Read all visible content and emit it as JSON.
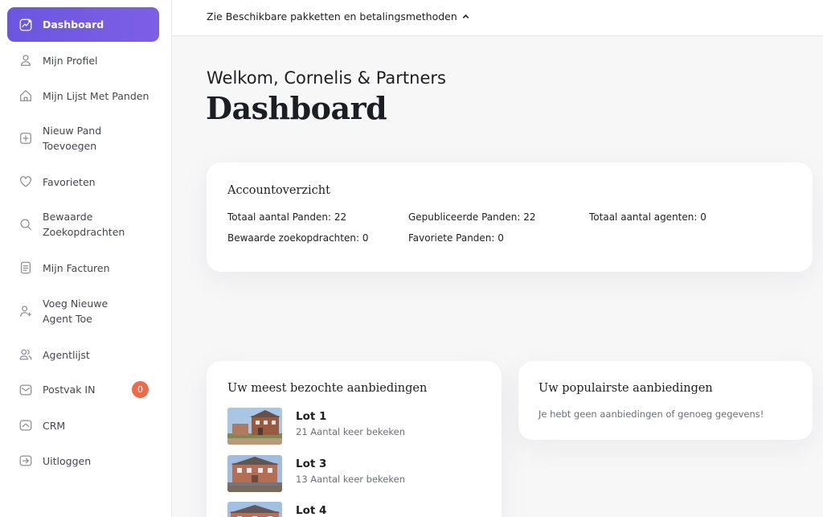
{
  "sidebar": {
    "items": [
      {
        "label": "Dashboard",
        "icon": "chart-icon",
        "active": true
      },
      {
        "label": "Mijn Profiel",
        "icon": "user-icon"
      },
      {
        "label": "Mijn Lijst Met Panden",
        "icon": "home-icon"
      },
      {
        "label": "Nieuw Pand Toevoegen",
        "icon": "plus-square-icon"
      },
      {
        "label": "Favorieten",
        "icon": "heart-icon"
      },
      {
        "label": "Bewaarde Zoekopdrachten",
        "icon": "search-icon"
      },
      {
        "label": "Mijn Facturen",
        "icon": "invoice-icon"
      },
      {
        "label": "Voeg Nieuwe Agent Toe",
        "icon": "user-add-icon"
      },
      {
        "label": "Agentlijst",
        "icon": "users-icon"
      },
      {
        "label": "Postvak IN",
        "icon": "mail-icon",
        "badge": "0"
      },
      {
        "label": "CRM",
        "icon": "crm-icon"
      },
      {
        "label": "Uitloggen",
        "icon": "logout-icon"
      }
    ]
  },
  "topbar": {
    "packages_label": "Zie Beschikbare pakketten en betalingsmethoden"
  },
  "header": {
    "welcome": "Welkom, Cornelis & Partners",
    "title": "Dashboard"
  },
  "account": {
    "title": "Accountoverzicht",
    "stats": [
      "Totaal aantal Panden: 22",
      "Gepubliceerde Panden: 22",
      "Totaal aantal agenten: 0",
      "Bewaarde zoekopdrachten: 0",
      "Favoriete Panden: 0"
    ]
  },
  "visited": {
    "title": "Uw meest bezochte aanbiedingen",
    "items": [
      {
        "name": "Lot 1",
        "views": "21 Aantal keer bekeken"
      },
      {
        "name": "Lot 3",
        "views": "13 Aantal keer bekeken"
      },
      {
        "name": "Lot 4",
        "views": ""
      }
    ]
  },
  "popular": {
    "title": "Uw populairste aanbiedingen",
    "empty": "Je hebt geen aanbiedingen of genoeg gegevens!"
  },
  "colors": {
    "accent": "#6c56e0",
    "badge": "#f06a4a"
  }
}
